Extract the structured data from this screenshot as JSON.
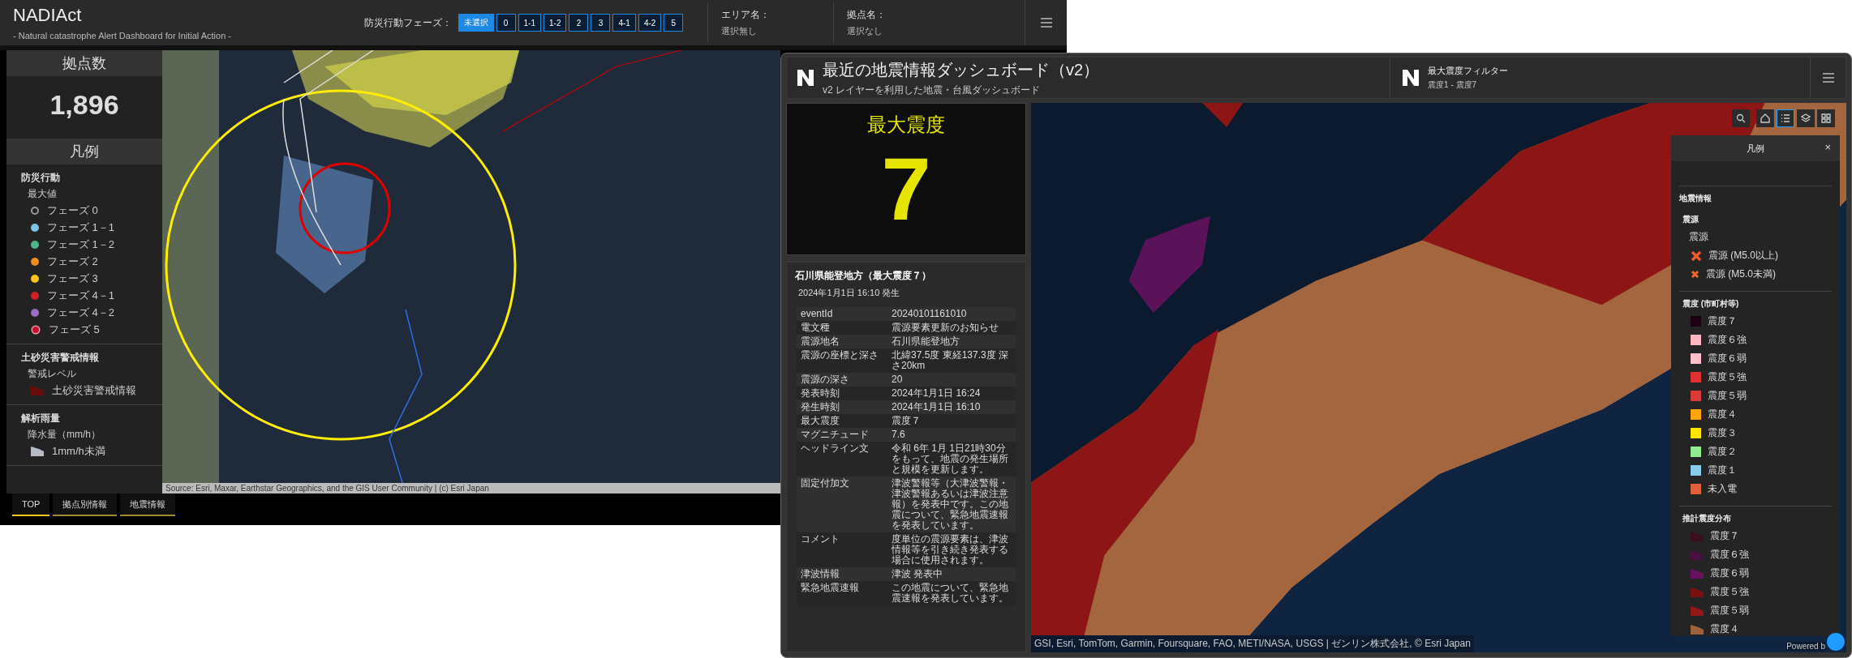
{
  "nadiact": {
    "title": "NADIAct",
    "subtitle": "- Natural catastrophe Alert Dashboard for Initial Action -",
    "phase_label": "防災行動フェーズ：",
    "phases": [
      {
        "label": "未選択",
        "selected": true
      },
      {
        "label": "0",
        "selected": false
      },
      {
        "label": "1-1",
        "selected": false
      },
      {
        "label": "1-2",
        "selected": false
      },
      {
        "label": "2",
        "selected": false
      },
      {
        "label": "3",
        "selected": false
      },
      {
        "label": "4-1",
        "selected": false
      },
      {
        "label": "4-2",
        "selected": false
      },
      {
        "label": "5",
        "selected": false
      }
    ],
    "area": {
      "label": "エリア名：",
      "value": "選択無し"
    },
    "site": {
      "label": "拠点名：",
      "value": "選択なし"
    },
    "kpi": {
      "title": "拠点数",
      "value": "1,896"
    },
    "legend": {
      "title": "凡例",
      "sections": [
        {
          "title": "防災行動",
          "subtitle": "最大値",
          "items": [
            {
              "kind": "ring",
              "label": "フェーズ 0",
              "color": "#9a9a9a"
            },
            {
              "kind": "dot",
              "label": "フェーズ 1－1",
              "color": "#7ec3e6"
            },
            {
              "kind": "dot",
              "label": "フェーズ 1－2",
              "color": "#4fb38a"
            },
            {
              "kind": "dot",
              "label": "フェーズ 2",
              "color": "#f08a24"
            },
            {
              "kind": "dot",
              "label": "フェーズ 3",
              "color": "#f5c518"
            },
            {
              "kind": "dot",
              "label": "フェーズ 4－1",
              "color": "#d0202a"
            },
            {
              "kind": "dot",
              "label": "フェーズ 4－2",
              "color": "#9b6dc6"
            },
            {
              "kind": "ringdot",
              "label": "フェーズ 5",
              "color": "#c8102e"
            }
          ]
        },
        {
          "title": "土砂災害警戒情報",
          "subtitle": "警戒レベル",
          "items": [
            {
              "kind": "polygon",
              "label": "土砂災害警戒情報",
              "color": "#6b0a0a"
            }
          ]
        },
        {
          "title": "解析雨量",
          "subtitle": "降水量（mm/h）",
          "items": [
            {
              "kind": "polygon",
              "label": "1mm/h未満",
              "color": "#b8bcc6"
            }
          ]
        }
      ]
    },
    "attribution": "Source: Esri, Maxar, Earthstar Geographics, and the GIS User Community | (c) Esri Japan",
    "tabs": [
      {
        "label": "TOP",
        "selected": true
      },
      {
        "label": "拠点別情報",
        "selected": false
      },
      {
        "label": "地震情報",
        "selected": false
      }
    ]
  },
  "quake_dashboard": {
    "title": "最近の地震情報ダッシュボード（v2）",
    "subtitle": "v2 レイヤーを利用した地震・台風ダッシュボード",
    "filter": {
      "title": "最大震度フィルター",
      "value": "震度1 - 震度7"
    },
    "max_intensity": {
      "title": "最大震度",
      "value": "7"
    },
    "event": {
      "title": "石川県能登地方（最大震度７）",
      "time": "2024年1月1日 16:10 発生",
      "rows": [
        {
          "key": "eventId",
          "value": "20240101161010"
        },
        {
          "key": "電文種",
          "value": "震源要素更新のお知らせ"
        },
        {
          "key": "震源地名",
          "value": "石川県能登地方"
        },
        {
          "key": "震源の座標と深さ",
          "value": "北緯37.5度 東経137.3度 深さ20km"
        },
        {
          "key": "震源の深さ",
          "value": "20"
        },
        {
          "key": "発表時刻",
          "value": "2024年1月1日 16:24"
        },
        {
          "key": "発生時刻",
          "value": "2024年1月1日 16:10"
        },
        {
          "key": "最大震度",
          "value": "震度７"
        },
        {
          "key": "マグニチュード",
          "value": "7.6"
        },
        {
          "key": "ヘッドライン文",
          "value": "令和 6年 1月 1日21時30分をもって、地震の発生場所と規模を更新します。"
        },
        {
          "key": "固定付加文",
          "value": "津波警報等（大津波警報・津波警報あるいは津波注意報）を発表中です。この地震について、緊急地震速報を発表しています。"
        },
        {
          "key": "コメント",
          "value": "度単位の震源要素は、津波情報等を引き続き発表する場合に使用されます。"
        },
        {
          "key": "津波情報",
          "value": "津波 発表中"
        },
        {
          "key": "緊急地震速報",
          "value": "この地震について、緊急地震速報を発表しています。"
        }
      ]
    },
    "toolbar": [
      {
        "kind": "search",
        "selected": false
      },
      {
        "kind": "home",
        "selected": false
      },
      {
        "kind": "list",
        "selected": true
      },
      {
        "kind": "layers",
        "selected": false
      },
      {
        "kind": "grid",
        "selected": false
      }
    ],
    "legend": {
      "title": "凡例",
      "close": "×",
      "group": "地震情報",
      "sections": [
        {
          "title": "震源",
          "subtitle": "震源",
          "items": [
            {
              "kind": "cross-large",
              "label": "震源 (M5.0以上)",
              "color": "#f05a28"
            },
            {
              "kind": "cross-small",
              "label": "震源 (M5.0未満)",
              "color": "#f26b2a"
            }
          ]
        },
        {
          "title": "震度 (市町村等)",
          "items": [
            {
              "kind": "square",
              "label": "震度７",
              "color": "#1a0010"
            },
            {
              "kind": "square",
              "label": "震度６強",
              "color": "#ffb6c1"
            },
            {
              "kind": "square",
              "label": "震度６弱",
              "color": "#ffc0cb"
            },
            {
              "kind": "square",
              "label": "震度５強",
              "color": "#e03030"
            },
            {
              "kind": "square",
              "label": "震度５弱",
              "color": "#d93a3a"
            },
            {
              "kind": "square",
              "label": "震度４",
              "color": "#ffa500"
            },
            {
              "kind": "square",
              "label": "震度３",
              "color": "#ffe600"
            },
            {
              "kind": "square",
              "label": "震度２",
              "color": "#90ee90"
            },
            {
              "kind": "square",
              "label": "震度１",
              "color": "#87ceeb"
            },
            {
              "kind": "square",
              "label": "未入電",
              "color": "#e0603a"
            }
          ]
        },
        {
          "title": "推計震度分布",
          "items": [
            {
              "kind": "polygon",
              "label": "震度７",
              "color": "#3a1020"
            },
            {
              "kind": "polygon",
              "label": "震度６強",
              "color": "#4a1040"
            },
            {
              "kind": "polygon",
              "label": "震度６弱",
              "color": "#6a1060"
            },
            {
              "kind": "polygon",
              "label": "震度５強",
              "color": "#7a1010"
            },
            {
              "kind": "polygon",
              "label": "震度５弱",
              "color": "#901818"
            },
            {
              "kind": "polygon",
              "label": "震度４",
              "color": "#a0603a"
            }
          ]
        }
      ]
    },
    "attribution": "GSI, Esri, TomTom, Garmin, Foursquare, FAO, METI/NASA, USGS | ゼンリン株式会社, © Esri Japan",
    "powered": "Powered b"
  }
}
